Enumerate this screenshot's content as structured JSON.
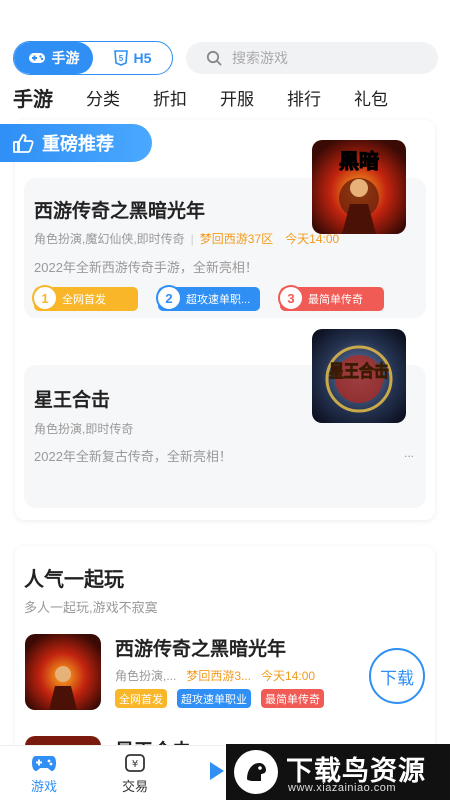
{
  "header": {
    "segment": {
      "mobile_label": "手游",
      "h5_label": "H5"
    },
    "search_placeholder": "搜索游戏",
    "tabs": [
      "手游",
      "分类",
      "折扣",
      "开服",
      "排行",
      "礼包"
    ]
  },
  "recommend": {
    "badge_label": "重磅推荐",
    "games": [
      {
        "title": "西游传奇之黑暗光年",
        "tags": "角色扮演,魔幻仙侠,即时传奇",
        "server": "梦回西游37区",
        "time": "今天14:00",
        "desc": "2022年全新西游传奇手游，全新亮相！",
        "features": [
          {
            "num": "1",
            "label": "全网首发"
          },
          {
            "num": "2",
            "label": "超攻速单职..."
          },
          {
            "num": "3",
            "label": "最简单传奇"
          }
        ],
        "thumb_text": "黑暗"
      },
      {
        "title": "星王合击",
        "tags": "角色扮演,即时传奇",
        "desc": "2022年全新复古传奇，全新亮相！",
        "more": "...",
        "thumb_text": "星王合击"
      }
    ]
  },
  "popular": {
    "title": "人气一起玩",
    "subtitle": "多人一起玩,游戏不寂寞",
    "item": {
      "name": "西游传奇之黑暗光年",
      "tags": "角色扮演,...",
      "server": "梦回西游3...",
      "time": "今天14:00",
      "chips": [
        "全网首发",
        "超攻速单职业",
        "最简单传奇"
      ],
      "download_label": "下载"
    },
    "item2_name": "星王合击"
  },
  "bottom_nav": {
    "game_label": "游戏",
    "trade_label": "交易"
  },
  "watermark": {
    "text": "下载鸟资源",
    "url": "www.xiazainiao.com"
  },
  "colors": {
    "primary": "#2f8ff5",
    "orange": "#f8b628",
    "red": "#f15b55"
  }
}
